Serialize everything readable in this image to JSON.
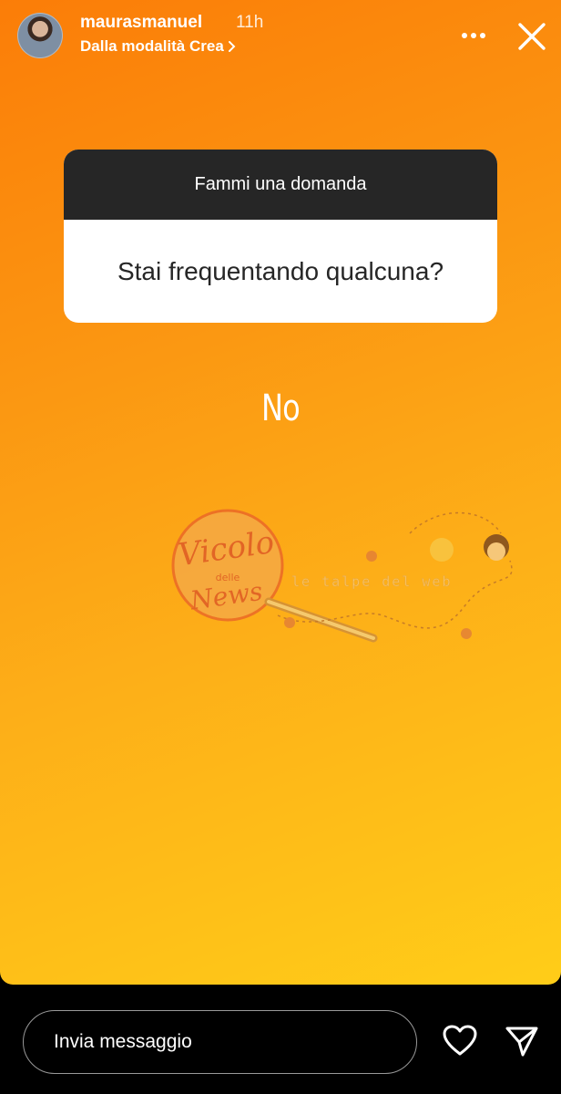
{
  "header": {
    "username": "maurasmanuel",
    "time": "11h",
    "subline": "Dalla modalità Crea",
    "subline_chevron": "chevron-right-icon",
    "more_icon": "more-horizontal-icon",
    "close_icon": "close-icon"
  },
  "question_sticker": {
    "prompt": "Fammi una domanda",
    "question": "Stai frequentando qualcuna?"
  },
  "answer": "No",
  "watermark": {
    "logo_line1": "Vicolo",
    "logo_line2": "delle",
    "logo_line3": "News",
    "tagline": "le talpe del web"
  },
  "footer": {
    "message_placeholder": "Invia messaggio",
    "like_icon": "heart-icon",
    "send_icon": "send-icon"
  },
  "colors": {
    "gradient_start": "#fb7d08",
    "gradient_end": "#ffcd18",
    "card_header": "#262626",
    "card_body": "#ffffff"
  }
}
